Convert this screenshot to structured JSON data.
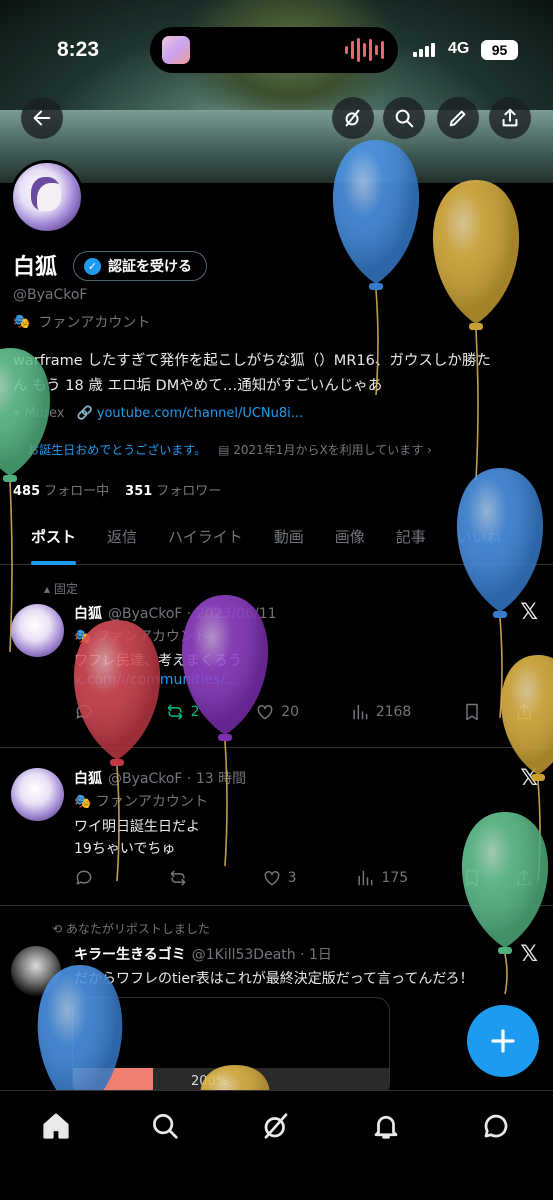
{
  "status_bar": {
    "time": "8:23",
    "network": "4G",
    "battery": "95"
  },
  "profile": {
    "name": "白狐",
    "verify_label": "認証を受ける",
    "handle": "@ByaCkoF",
    "fan_label": "ファンアカウント",
    "bio_line1": "warframe したすぎて発作を起こしがちな狐（）MR16、ガウスしか勝た",
    "bio_line2": "ん もう 18 歳 エロ垢 DMやめて…通知がすごいんじゃあ",
    "location": "Murex",
    "link": "youtube.com/channel/UCNu8i...",
    "birthday": "お誕生日おめでとうございます。",
    "joined": "2021年1月からXを利用しています",
    "following_count": "485",
    "following_label": "フォロー中",
    "followers_count": "351",
    "followers_label": "フォロワー"
  },
  "tabs": [
    "ポスト",
    "返信",
    "ハイライト",
    "動画",
    "画像",
    "記事",
    "いいね"
  ],
  "posts": [
    {
      "pinned_label": "固定",
      "author": "白狐",
      "handle_time": "@ByaCkoF · 2023/06/11",
      "sub": "ファンアカウント",
      "line1": "ワフレ民達、考えまくろう",
      "link": "x.com/i/communities/...",
      "retweets": "2",
      "likes": "20",
      "views": "2168"
    },
    {
      "author": "白狐",
      "handle_time": "@ByaCkoF · 13 時間",
      "sub": "ファンアカウント",
      "line1": "ワイ明日誕生日だよ",
      "line2": "19ちゃいでちゅ",
      "likes": "3",
      "views": "175"
    },
    {
      "repost_label": "あなたがリポストしました",
      "author": "キラー生きるゴミ",
      "handle_time": "@1Kill53Death · 1日",
      "line1": "だからワフレのtier表はこれが最終決定版だって言ってんだろ！",
      "media_pct": "200%"
    }
  ],
  "colors": {
    "accent": "#1d9bf0",
    "background": "#000000",
    "muted": "#71767b"
  },
  "balloon_colors": [
    "#3f8ee8",
    "#e3b53a",
    "#5cc78f",
    "#d9404f",
    "#8e36c8",
    "#3f8ee8",
    "#e3b53a",
    "#5cc78f"
  ]
}
